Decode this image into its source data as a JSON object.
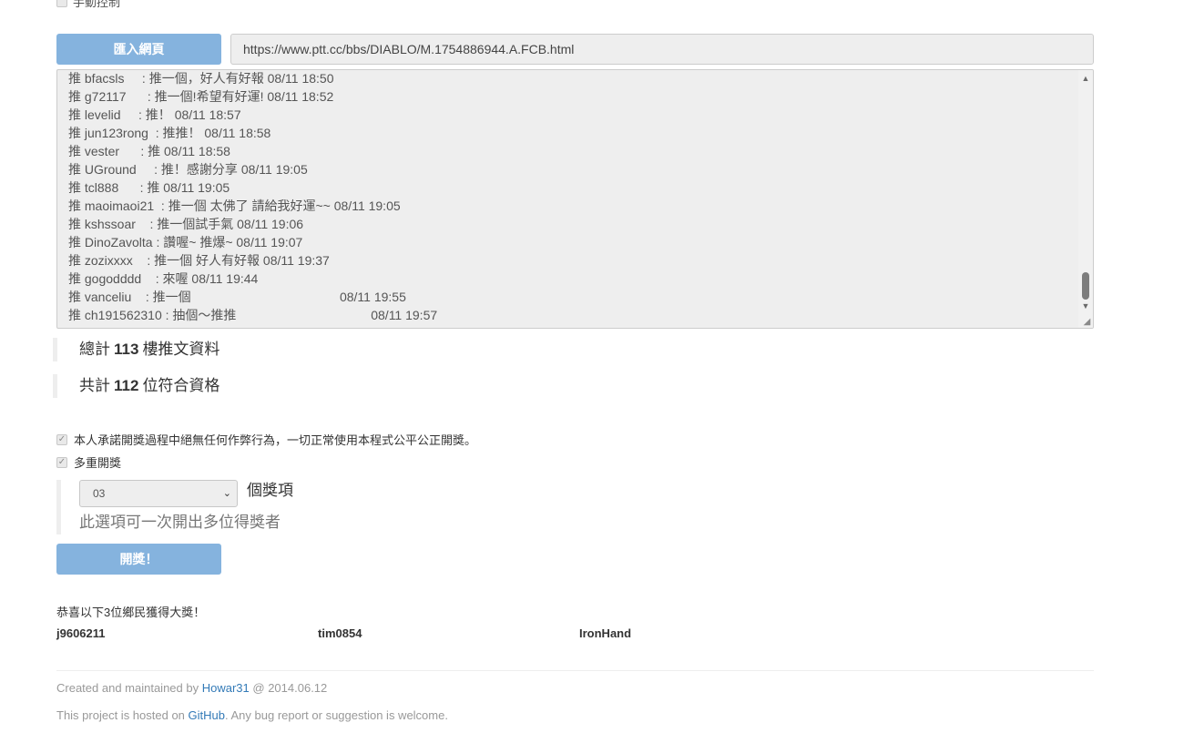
{
  "top_option": {
    "label": "手動控制"
  },
  "import_section": {
    "button_label": "匯入網頁",
    "url_value": "https://www.ptt.cc/bbs/DIABLO/M.1754886944.A.FCB.html"
  },
  "comments": [
    "推 bfacsls     : 推一個，好人有好報 08/11 18:50",
    "推 g72117      : 推一個!希望有好運! 08/11 18:52",
    "推 levelid     : 推！ 08/11 18:57",
    "推 jun123rong  : 推推！ 08/11 18:58",
    "推 vester      : 推 08/11 18:58",
    "推 UGround     : 推！感謝分享 08/11 19:05",
    "推 tcl888      : 推 08/11 19:05",
    "推 maoimaoi21  : 推一個 太佛了 請給我好運~~ 08/11 19:05",
    "推 kshssoar    : 推一個試手氣 08/11 19:06",
    "推 DinoZavolta : 讚喔~ 推爆~ 08/11 19:07",
    "推 zozixxxx    : 推一個 好人有好報 08/11 19:37",
    "推 gogodddd    : 來喔 08/11 19:44",
    "推 vanceliu    : 推一個                                          08/11 19:55",
    "推 ch191562310 : 抽個～推推                                      08/11 19:57"
  ],
  "stats": {
    "total_prefix": "總計",
    "total_count": "113",
    "total_suffix": "樓推文資料",
    "qualified_prefix": "共計",
    "qualified_count": "112",
    "qualified_suffix": "位符合資格"
  },
  "options": {
    "pledge_label": "本人承諾開獎過程中絕無任何作弊行為，一切正常使用本程式公平公正開獎。",
    "pledge_checked": true,
    "multi_label": "多重開獎",
    "multi_checked": true,
    "prize_count_value": "03",
    "prize_count_suffix": "個獎項",
    "help_text": "此選項可一次開出多位得獎者"
  },
  "draw_button_label": "開獎！",
  "result": {
    "congrats_text": "恭喜以下3位鄉民獲得大獎！",
    "winners": [
      "j9606211",
      "tim0854",
      "IronHand"
    ]
  },
  "footer": {
    "line1_prefix": "Created and maintained by",
    "author": "Howar31",
    "line1_suffix": "@ 2014.06.12",
    "line2_prefix": "This project is hosted on",
    "host": "GitHub",
    "line2_suffix": ". Any bug report or suggestion is welcome."
  },
  "colors": {
    "button_bg": "#85b3de",
    "link": "#337ab7",
    "muted": "#999999"
  }
}
